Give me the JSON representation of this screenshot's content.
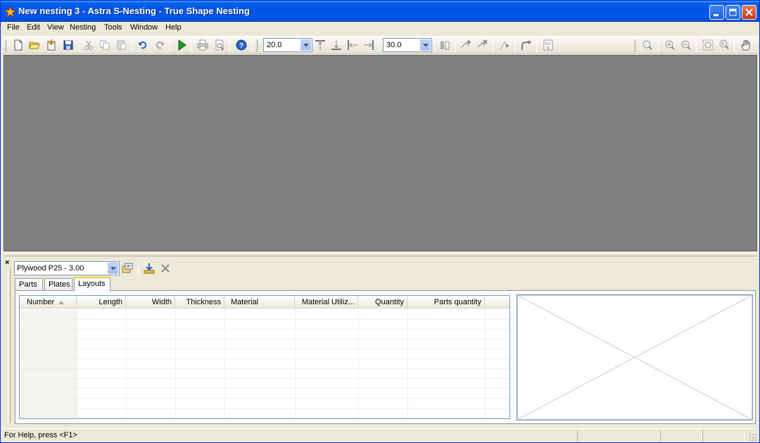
{
  "window": {
    "title": "New nesting 3 - Astra S-Nesting - True Shape Nesting"
  },
  "menu": [
    "File",
    "Edit",
    "View",
    "Nesting",
    "Tools",
    "Window",
    "Help"
  ],
  "toolbar": {
    "gap_value": "20.0",
    "offset_value": "30.0"
  },
  "panel": {
    "close_label": "×",
    "material_selected": "Plywood P25 - 3.00",
    "tabs": [
      "Parts",
      "Plates",
      "Layouts"
    ],
    "active_tab": "Layouts",
    "columns": [
      "Number",
      "Length",
      "Width",
      "Thickness",
      "Material",
      "Material Utiliz...",
      "Quantity",
      "Parts quantity"
    ]
  },
  "status": {
    "help_text": "For Help, press <F1>"
  },
  "colors": {
    "title_bar": "#0054e3",
    "workspace": "#808080",
    "chrome": "#ece9d8",
    "active_tab_accent": "#ffc83c"
  }
}
